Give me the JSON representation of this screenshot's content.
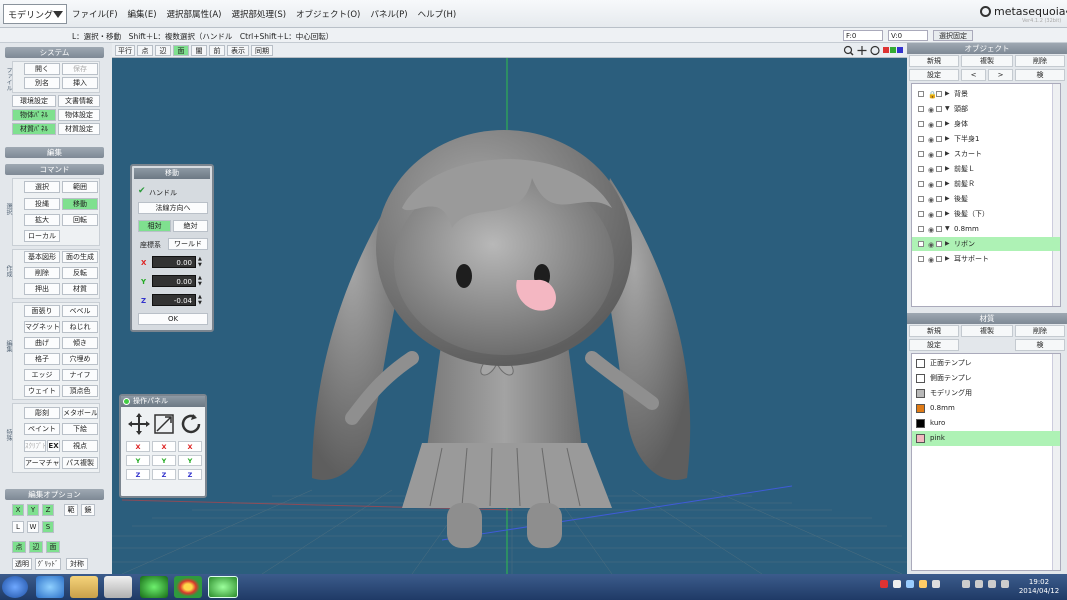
{
  "app": {
    "mode": "モデリング",
    "menu": [
      "ファイル(F)",
      "編集(E)",
      "選択部属性(A)",
      "選択部処理(S)",
      "オブジェクト(O)",
      "パネル(P)",
      "ヘルプ(H)"
    ],
    "logo": "metasequoia",
    "version": "4",
    "version_sub": "Ver4.1.2 (32bit)",
    "hint": "L：選択・移動　Shift＋L：複数選択（ハンドル　Ctrl+Shift＋L：中心回転）",
    "field_f": "F:0",
    "field_v": "V:0",
    "select_fix": "選択固定"
  },
  "view_toolbar": [
    "平行",
    "点",
    "辺",
    "面",
    "闇",
    "前",
    "表示",
    "同期"
  ],
  "left": {
    "system_title": "システム",
    "file_label": "ファイル",
    "open": "開く",
    "save": "保存",
    "save_as": "別名",
    "insert": "挿入",
    "env": "環境設定",
    "doc": "文書情報",
    "obj_panel": "物体ﾊﾟﾈﾙ",
    "obj_settings": "物体設定",
    "mat_panel": "材質ﾊﾟﾈﾙ",
    "mat_settings": "材質設定",
    "edit_title": "編集",
    "command_title": "コマンド",
    "sel_group": "選択",
    "select": "選択",
    "range": "範囲",
    "lasso": "投縄",
    "move": "移動",
    "scale": "拡大",
    "rotate": "回転",
    "local": "ローカル",
    "create_group": "作成",
    "basic": "基本図形",
    "face_gen": "面の生成",
    "delete": "削除",
    "flip": "反転",
    "extrude": "押出",
    "material": "材質",
    "mod_group": "編集",
    "face_pull": "面張り",
    "bevel": "ベベル",
    "magnet": "マグネット",
    "twist": "ねじれ",
    "bend": "曲げ",
    "tilt": "傾き",
    "grid": "格子",
    "hole": "穴埋め",
    "edge": "エッジ",
    "knife": "ナイフ",
    "weight": "ウェイト",
    "vcolor": "頂点色",
    "special_group": "特殊",
    "sculpt": "彫刻",
    "metaball": "メタボール",
    "paint": "ペイント",
    "underlay": "下絵",
    "script": "ｽｸﾘﾌﾟﾄ",
    "ex": "EX",
    "view": "視点",
    "armature": "アーマチャー",
    "path_dup": "パス複製",
    "opt_title": "編集オプション",
    "x": "X",
    "y": "Y",
    "z": "Z",
    "near": "範",
    "mirror": "鏡",
    "l": "L",
    "w": "W",
    "s": "S",
    "pt": "点",
    "edge2": "辺",
    "face": "面",
    "transparent": "透明",
    "gridopt": "ｸﾞﾘｯﾄﾞ",
    "sym": "対称"
  },
  "move_panel": {
    "title": "移動",
    "handle": "ハンドル",
    "normal": "法線方向へ",
    "relative": "相対",
    "absolute": "絶対",
    "coord": "座標系",
    "world": "ワールド",
    "x_label": "X",
    "y_label": "Y",
    "z_label": "Z",
    "x": "0.00",
    "y": "0.00",
    "z": "-0.04",
    "ok": "OK"
  },
  "ops_panel": {
    "title": "操作パネル",
    "x": "X",
    "y": "Y",
    "z": "Z"
  },
  "objects": {
    "title": "オブジェクト",
    "new": "新規",
    "dup": "複製",
    "del": "削除",
    "settings": "設定",
    "prev": "<",
    "next": ">",
    "search": "検",
    "items": [
      {
        "name": "背景",
        "locked": true,
        "expanded": false,
        "selected": false
      },
      {
        "name": "頭部",
        "locked": false,
        "expanded": true,
        "selected": false
      },
      {
        "name": "身体",
        "locked": false,
        "expanded": false,
        "selected": false
      },
      {
        "name": "下半身1",
        "locked": false,
        "expanded": false,
        "selected": false
      },
      {
        "name": "スカート",
        "locked": false,
        "expanded": false,
        "selected": false
      },
      {
        "name": "前髪Ｌ",
        "locked": false,
        "expanded": false,
        "selected": false
      },
      {
        "name": "前髪Ｒ",
        "locked": false,
        "expanded": false,
        "selected": false
      },
      {
        "name": "後髪",
        "locked": false,
        "expanded": false,
        "selected": false
      },
      {
        "name": "後髪（下）",
        "locked": false,
        "expanded": false,
        "selected": false
      },
      {
        "name": "0.8mm",
        "locked": false,
        "expanded": true,
        "selected": false
      },
      {
        "name": "リボン",
        "locked": false,
        "expanded": false,
        "selected": true
      },
      {
        "name": "耳サポート",
        "locked": false,
        "expanded": false,
        "selected": false
      }
    ]
  },
  "materials": {
    "title": "材質",
    "new": "新規",
    "dup": "複製",
    "del": "削除",
    "settings": "設定",
    "search": "検",
    "items": [
      {
        "name": "正面テンプレ",
        "color": "#ffffff",
        "selected": false
      },
      {
        "name": "側面テンプレ",
        "color": "#ffffff",
        "selected": false
      },
      {
        "name": "モデリング用",
        "color": "#b8b8b8",
        "selected": false
      },
      {
        "name": "0.8mm",
        "color": "#e07b16",
        "selected": false
      },
      {
        "name": "kuro",
        "color": "#000000",
        "selected": false
      },
      {
        "name": "pink",
        "color": "#f2b9c0",
        "selected": true
      }
    ]
  },
  "taskbar": {
    "time": "19:02",
    "date": "2014/04/12"
  },
  "colors": {
    "viewport": "#2b5e7d",
    "accent": "#7fe08f",
    "selected_row": "#aef2b5"
  }
}
